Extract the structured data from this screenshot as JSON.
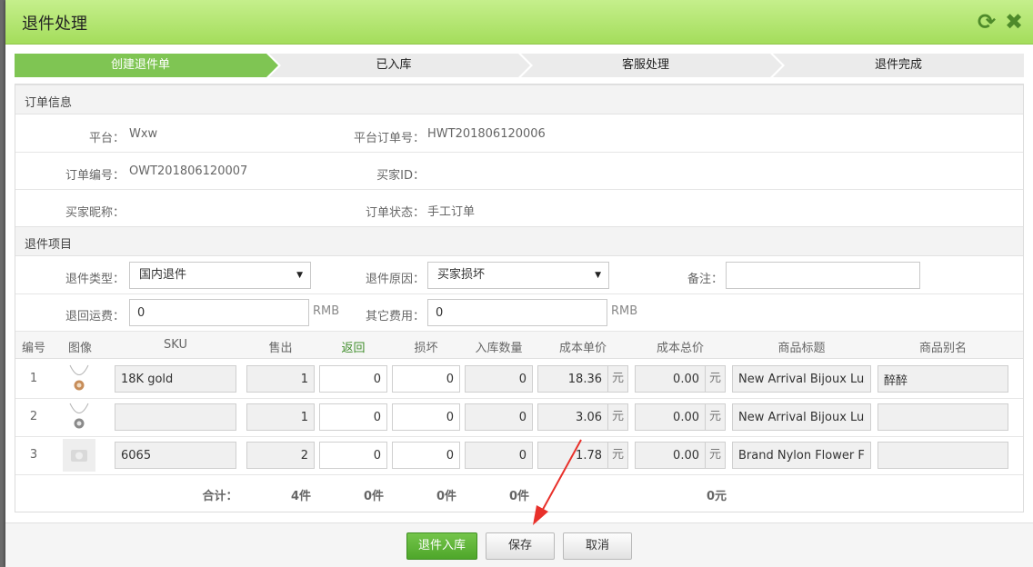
{
  "dialog": {
    "title": "退件处理",
    "refresh_icon": "refresh-icon",
    "close_icon": "close-icon"
  },
  "steps": [
    {
      "label": "创建退件单",
      "active": true
    },
    {
      "label": "已入库",
      "active": false
    },
    {
      "label": "客服处理",
      "active": false
    },
    {
      "label": "退件完成",
      "active": false
    }
  ],
  "order_info": {
    "heading": "订单信息",
    "platform_label": "平台：",
    "platform_value": "Wxw",
    "platform_order_label": "平台订单号：",
    "platform_order_value": "HWT201806120006",
    "order_no_label": "订单编号：",
    "order_no_value": "OWT201806120007",
    "buyer_id_label": "买家ID：",
    "buyer_id_value": "",
    "buyer_nick_label": "买家昵称：",
    "buyer_nick_value": "",
    "order_status_label": "订单状态：",
    "order_status_value": "手工订单"
  },
  "return_items": {
    "heading": "退件项目",
    "return_type_label": "退件类型：",
    "return_type_value": "国内退件",
    "return_reason_label": "退件原因：",
    "return_reason_value": "买家损坏",
    "remark_label": "备注：",
    "remark_value": "",
    "return_freight_label": "退回运费：",
    "return_freight_value": "0",
    "return_freight_unit": "RMB",
    "other_fee_label": "其它费用：",
    "other_fee_value": "0",
    "other_fee_unit": "RMB"
  },
  "table": {
    "headers": {
      "no": "编号",
      "image": "图像",
      "sku": "SKU",
      "sold": "售出",
      "returned": "返回",
      "damaged": "损坏",
      "in_qty": "入库数量",
      "unit_cost": "成本单价",
      "total_cost": "成本总价",
      "title": "商品标题",
      "alias": "商品别名"
    },
    "currency_unit": "元",
    "rows": [
      {
        "no": "1",
        "sku": "18K gold",
        "sold": "1",
        "returned": "0",
        "damaged": "0",
        "in_qty": "0",
        "unit_cost": "18.36",
        "total_cost": "0.00",
        "title": "New Arrival Bijoux Luxur",
        "alias": "醉醉"
      },
      {
        "no": "2",
        "sku": "",
        "sold": "1",
        "returned": "0",
        "damaged": "0",
        "in_qty": "0",
        "unit_cost": "3.06",
        "total_cost": "0.00",
        "title": "New Arrival Bijoux Luxur",
        "alias": ""
      },
      {
        "no": "3",
        "sku": "6065",
        "sold": "2",
        "returned": "0",
        "damaged": "0",
        "in_qty": "0",
        "unit_cost": "1.78",
        "total_cost": "0.00",
        "title": "Brand Nylon Flower Flor",
        "alias": ""
      }
    ],
    "totals": {
      "label": "合计：",
      "sold": "4件",
      "returned": "0件",
      "damaged": "0件",
      "in_qty": "0件",
      "total_cost": "0元"
    }
  },
  "footer": {
    "return_in_label": "退件入库",
    "save_label": "保存",
    "cancel_label": "取消"
  },
  "colors": {
    "accent_green": "#7fc553",
    "title_green": "#a4dd5c",
    "annotation_red": "#e8302a"
  }
}
